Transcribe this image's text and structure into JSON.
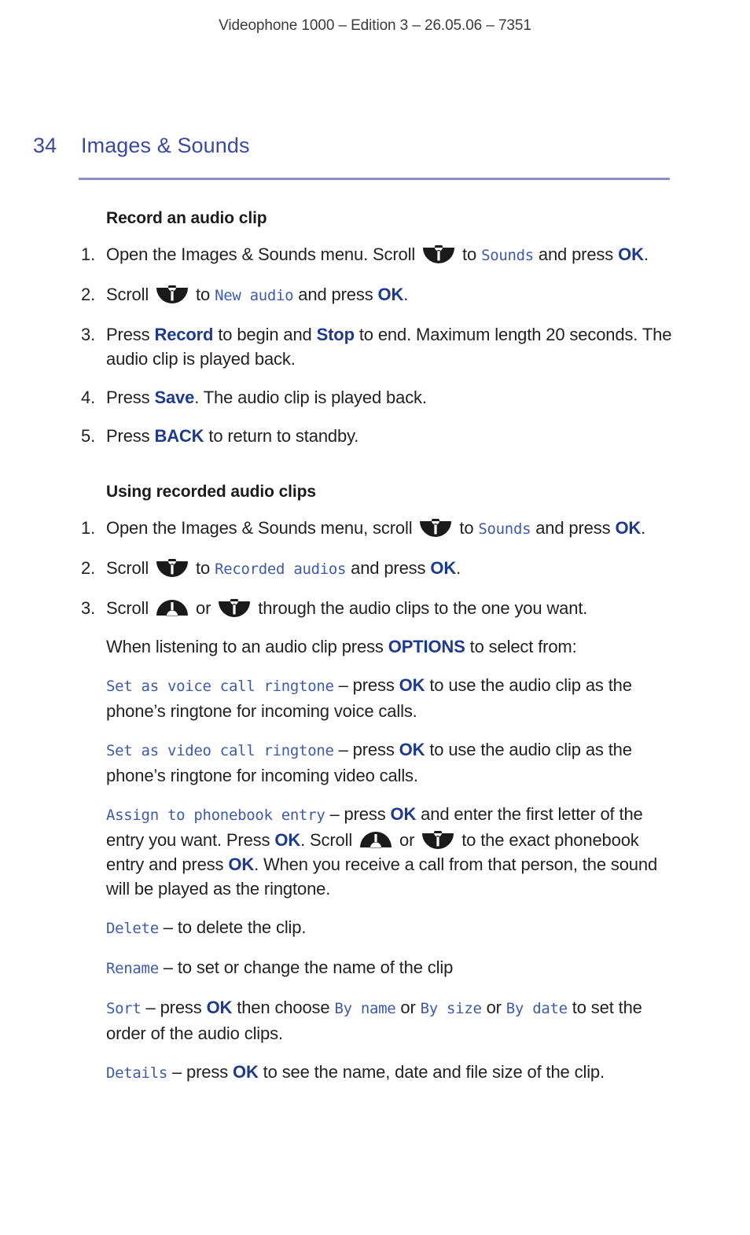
{
  "running_header": "Videophone 1000 – Edition 3 – 26.05.06 – 7351",
  "page": {
    "folio": "34",
    "chapter": "Images & Sounds"
  },
  "colors": {
    "heading_blue": "#3b4a9e",
    "rule_lavender": "#8c8fc4",
    "key_blue": "#1e3a8c",
    "lcd_blue": "#3d5ba9",
    "body_black": "#231f20"
  },
  "icons": {
    "scroll_up": "scroll-up-key-icon",
    "scroll_down": "scroll-down-key-icon"
  },
  "sections": [
    {
      "title": "Record an audio clip",
      "steps": [
        {
          "num": "1.",
          "parts": [
            {
              "t": "text",
              "v": "Open the Images & Sounds menu. Scroll "
            },
            {
              "t": "icon",
              "v": "scroll-down"
            },
            {
              "t": "text",
              "v": " to "
            },
            {
              "t": "lcd",
              "v": "Sounds"
            },
            {
              "t": "text",
              "v": " and press "
            },
            {
              "t": "key",
              "v": "OK"
            },
            {
              "t": "text",
              "v": "."
            }
          ]
        },
        {
          "num": "2.",
          "parts": [
            {
              "t": "text",
              "v": "Scroll "
            },
            {
              "t": "icon",
              "v": "scroll-down"
            },
            {
              "t": "text",
              "v": " to "
            },
            {
              "t": "lcd",
              "v": "New audio"
            },
            {
              "t": "text",
              "v": " and press "
            },
            {
              "t": "key",
              "v": "OK"
            },
            {
              "t": "text",
              "v": "."
            }
          ]
        },
        {
          "num": "3.",
          "parts": [
            {
              "t": "text",
              "v": "Press "
            },
            {
              "t": "key",
              "v": "Record"
            },
            {
              "t": "text",
              "v": " to begin and "
            },
            {
              "t": "key",
              "v": "Stop"
            },
            {
              "t": "text",
              "v": " to end. Maximum length 20 seconds. The audio clip is played back."
            }
          ]
        },
        {
          "num": "4.",
          "parts": [
            {
              "t": "text",
              "v": "Press "
            },
            {
              "t": "key",
              "v": "Save"
            },
            {
              "t": "text",
              "v": ". The audio clip is played back."
            }
          ]
        },
        {
          "num": "5.",
          "parts": [
            {
              "t": "text",
              "v": "Press "
            },
            {
              "t": "key",
              "v": "BACK"
            },
            {
              "t": "text",
              "v": " to return to standby."
            }
          ]
        }
      ]
    },
    {
      "title": "Using recorded audio clips",
      "steps": [
        {
          "num": "1.",
          "parts": [
            {
              "t": "text",
              "v": "Open the Images & Sounds menu, scroll "
            },
            {
              "t": "icon",
              "v": "scroll-down"
            },
            {
              "t": "text",
              "v": " to "
            },
            {
              "t": "lcd",
              "v": "Sounds"
            },
            {
              "t": "text",
              "v": " and press "
            },
            {
              "t": "key",
              "v": "OK"
            },
            {
              "t": "text",
              "v": "."
            }
          ]
        },
        {
          "num": "2.",
          "parts": [
            {
              "t": "text",
              "v": "Scroll "
            },
            {
              "t": "icon",
              "v": "scroll-down"
            },
            {
              "t": "text",
              "v": " to "
            },
            {
              "t": "lcd",
              "v": "Recorded audios"
            },
            {
              "t": "text",
              "v": " and press "
            },
            {
              "t": "key",
              "v": "OK"
            },
            {
              "t": "text",
              "v": "."
            }
          ]
        },
        {
          "num": "3.",
          "parts": [
            {
              "t": "text",
              "v": "Scroll "
            },
            {
              "t": "icon",
              "v": "scroll-up"
            },
            {
              "t": "text",
              "v": " or "
            },
            {
              "t": "icon",
              "v": "scroll-down"
            },
            {
              "t": "text",
              "v": " through the audio clips to the one you want."
            }
          ]
        }
      ],
      "paragraphs": [
        {
          "parts": [
            {
              "t": "text",
              "v": "When listening to an audio clip press "
            },
            {
              "t": "key",
              "v": "OPTIONS"
            },
            {
              "t": "text",
              "v": " to select from:"
            }
          ]
        },
        {
          "parts": [
            {
              "t": "lcd",
              "v": "Set as voice call ringtone"
            },
            {
              "t": "text",
              "v": " – press "
            },
            {
              "t": "key",
              "v": "OK"
            },
            {
              "t": "text",
              "v": " to use the audio clip as the phone’s ringtone for incoming voice calls."
            }
          ]
        },
        {
          "parts": [
            {
              "t": "lcd",
              "v": "Set as video call ringtone"
            },
            {
              "t": "text",
              "v": " – press "
            },
            {
              "t": "key",
              "v": "OK"
            },
            {
              "t": "text",
              "v": " to use the audio clip as the phone’s ringtone for incoming video calls."
            }
          ]
        },
        {
          "parts": [
            {
              "t": "lcd",
              "v": "Assign to phonebook entry"
            },
            {
              "t": "text",
              "v": " – press "
            },
            {
              "t": "key",
              "v": "OK"
            },
            {
              "t": "text",
              "v": " and enter the first letter of the entry you want. Press "
            },
            {
              "t": "key",
              "v": "OK"
            },
            {
              "t": "text",
              "v": ". Scroll "
            },
            {
              "t": "icon",
              "v": "scroll-up"
            },
            {
              "t": "text",
              "v": " or "
            },
            {
              "t": "icon",
              "v": "scroll-down"
            },
            {
              "t": "text",
              "v": " to the exact phonebook entry and press "
            },
            {
              "t": "key",
              "v": "OK"
            },
            {
              "t": "text",
              "v": ". When you receive a call from that person, the sound will be played as the ringtone."
            }
          ]
        },
        {
          "parts": [
            {
              "t": "lcd",
              "v": "Delete"
            },
            {
              "t": "text",
              "v": " – to delete the clip."
            }
          ]
        },
        {
          "parts": [
            {
              "t": "lcd",
              "v": "Rename"
            },
            {
              "t": "text",
              "v": " – to set or change the name of the clip"
            }
          ]
        },
        {
          "parts": [
            {
              "t": "lcd",
              "v": "Sort"
            },
            {
              "t": "text",
              "v": " – press "
            },
            {
              "t": "key",
              "v": "OK"
            },
            {
              "t": "text",
              "v": " then choose "
            },
            {
              "t": "lcd",
              "v": "By name"
            },
            {
              "t": "text",
              "v": " or "
            },
            {
              "t": "lcd",
              "v": "By size"
            },
            {
              "t": "text",
              "v": " or "
            },
            {
              "t": "lcd",
              "v": "By date"
            },
            {
              "t": "text",
              "v": " to set the order of the audio clips."
            }
          ]
        },
        {
          "parts": [
            {
              "t": "lcd",
              "v": "Details"
            },
            {
              "t": "text",
              "v": " – press "
            },
            {
              "t": "key",
              "v": "OK"
            },
            {
              "t": "text",
              "v": " to see the name, date and file size of the clip."
            }
          ]
        }
      ]
    }
  ]
}
